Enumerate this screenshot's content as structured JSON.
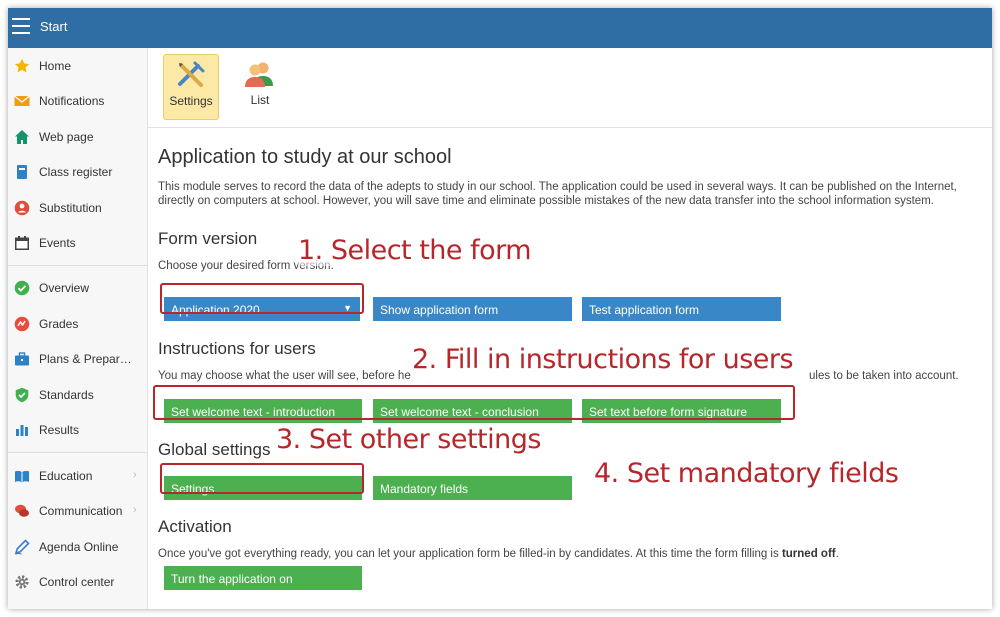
{
  "topbar": {
    "title": "Start"
  },
  "sidebar": {
    "items": [
      {
        "label": "Home",
        "icon": "star-icon"
      },
      {
        "label": "Notifications",
        "icon": "envelope-icon"
      },
      {
        "label": "Web page",
        "icon": "house-icon"
      },
      {
        "label": "Class register",
        "icon": "book-icon"
      },
      {
        "label": "Substitution",
        "icon": "person-swap-icon"
      },
      {
        "label": "Events",
        "icon": "calendar-icon"
      },
      {
        "label": "Overview",
        "icon": "check-circle-icon"
      },
      {
        "label": "Grades",
        "icon": "grades-icon"
      },
      {
        "label": "Plans & Preparations",
        "icon": "briefcase-icon"
      },
      {
        "label": "Standards",
        "icon": "shield-check-icon"
      },
      {
        "label": "Results",
        "icon": "bar-chart-icon"
      },
      {
        "label": "Education",
        "icon": "open-book-icon"
      },
      {
        "label": "Communication",
        "icon": "chat-icon"
      },
      {
        "label": "Agenda Online",
        "icon": "pen-icon"
      },
      {
        "label": "Control center",
        "icon": "gear-icon"
      }
    ]
  },
  "toolbar": {
    "settings_label": "Settings",
    "list_label": "List"
  },
  "main": {
    "title": "Application to study at our school",
    "description": "This module serves to record the data of the adepts to study in our school. The application could be used in several ways. It can be published on the Internet, directly on computers at school. However, you will save time and eliminate possible mistakes of the new data transfer into the school information system.",
    "form_version": {
      "heading": "Form version",
      "text": "Choose your desired form version.",
      "select_value": "Application 2020",
      "show_button": "Show application form",
      "test_button": "Test application form"
    },
    "instructions": {
      "heading": "Instructions for users",
      "text_start": "You may choose what the user will see, before he",
      "text_end": "ules to be taken into account.",
      "btn_intro": "Set welcome text - introduction",
      "btn_conclusion": "Set welcome text - conclusion",
      "btn_signature": "Set text before form signature"
    },
    "global": {
      "heading": "Global settings",
      "btn_settings": "Settings",
      "btn_mandatory": "Mandatory fields"
    },
    "activation": {
      "heading": "Activation",
      "text": "Once you've got everything ready, you can let your application form be filled-in by candidates. At this time the form filling is",
      "state": "turned off",
      "period": ".",
      "btn_turn_on": "Turn the application on"
    }
  },
  "annotations": {
    "step1": "1. Select the form",
    "step2": "2. Fill in instructions for users",
    "step3": "3. Set other settings",
    "step4": "4. Set mandatory fields"
  },
  "colors": {
    "topbar": "#2f6ea5",
    "button_blue": "#3a87c7",
    "button_green": "#4caf50",
    "annotation_red": "#b7262b",
    "active_tool": "#fbe9a5"
  }
}
